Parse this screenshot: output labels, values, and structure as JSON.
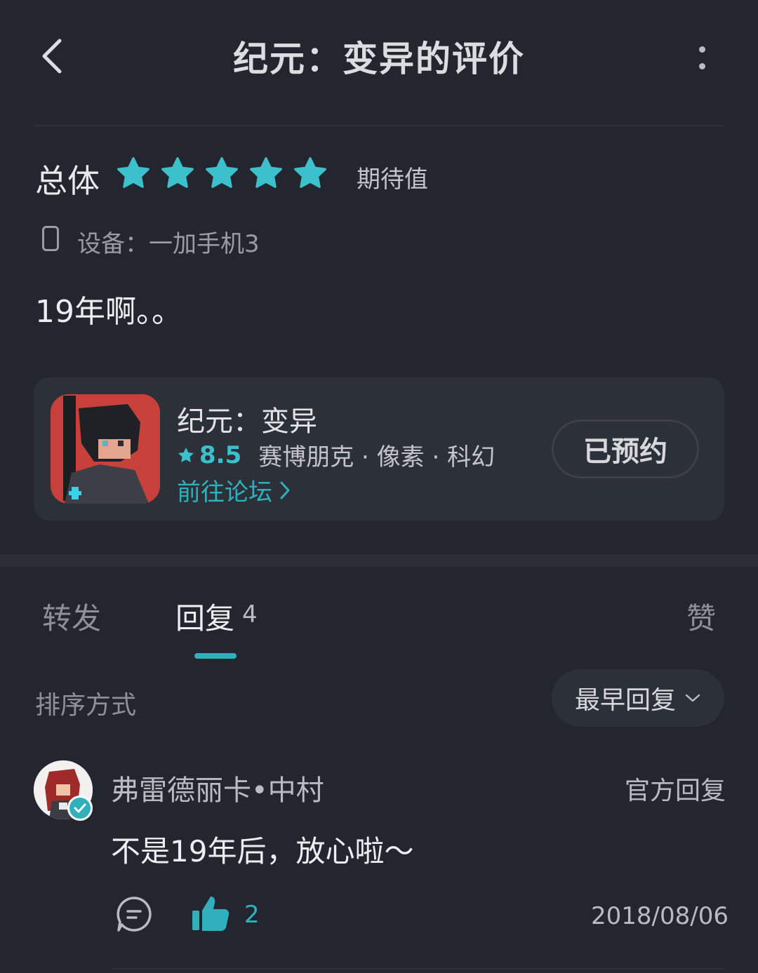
{
  "header": {
    "title": "纪元：变异的评价"
  },
  "review": {
    "overall_label": "总体",
    "rating_stars": 5,
    "expectation_label": "期待值",
    "device_label": "设备：一加手机3",
    "text": "19年啊。。"
  },
  "game": {
    "name": "纪元：变异",
    "score": "8.5",
    "tags": "赛博朋克 · 像素 · 科幻",
    "forum_link": "前往论坛",
    "reserve_button": "已预约"
  },
  "tabs": {
    "forward": "转发",
    "replies": "回复",
    "replies_count": "4",
    "likes": "赞"
  },
  "sort": {
    "label": "排序方式",
    "selected": "最早回复"
  },
  "reply": {
    "user": "弗雷德丽卡•中村",
    "tag": "官方回复",
    "text": "不是19年后，放心啦～",
    "like_count": "2",
    "date": "2018/08/06"
  },
  "colors": {
    "background": "#23262f",
    "accent": "#2fb0bc",
    "star": "#3bc0cc"
  }
}
